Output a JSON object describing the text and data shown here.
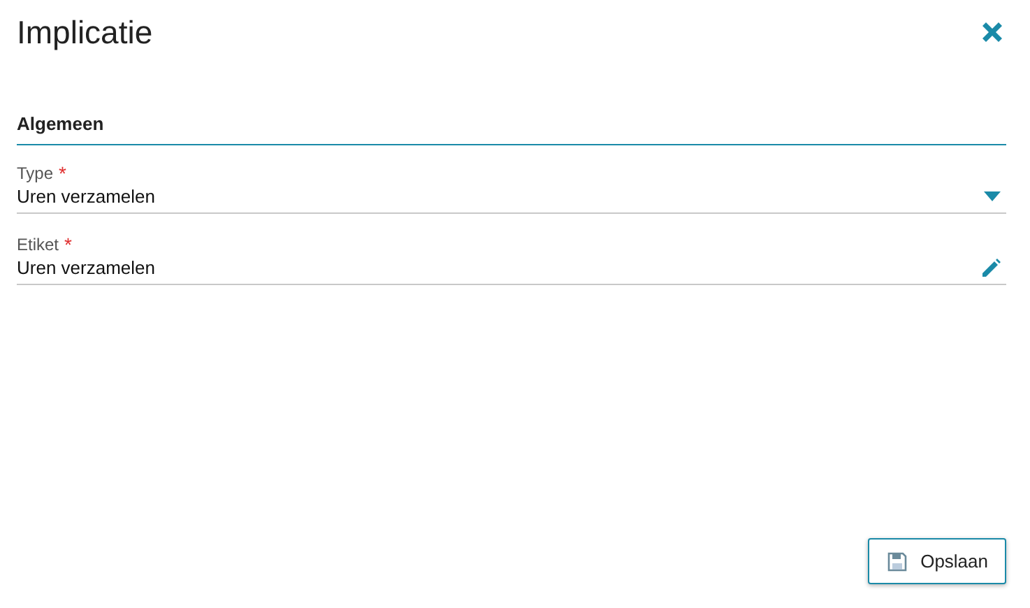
{
  "title": "Implicatie",
  "section": "Algemeen",
  "fields": [
    {
      "kind": "select",
      "label": "Type",
      "required_mark": "*",
      "value": "Uren verzamelen"
    },
    {
      "kind": "text",
      "label": "Etiket",
      "required_mark": "*",
      "value": "Uren verzamelen"
    }
  ],
  "buttons": [
    {
      "kind": "save",
      "label": "Opslaan"
    }
  ]
}
